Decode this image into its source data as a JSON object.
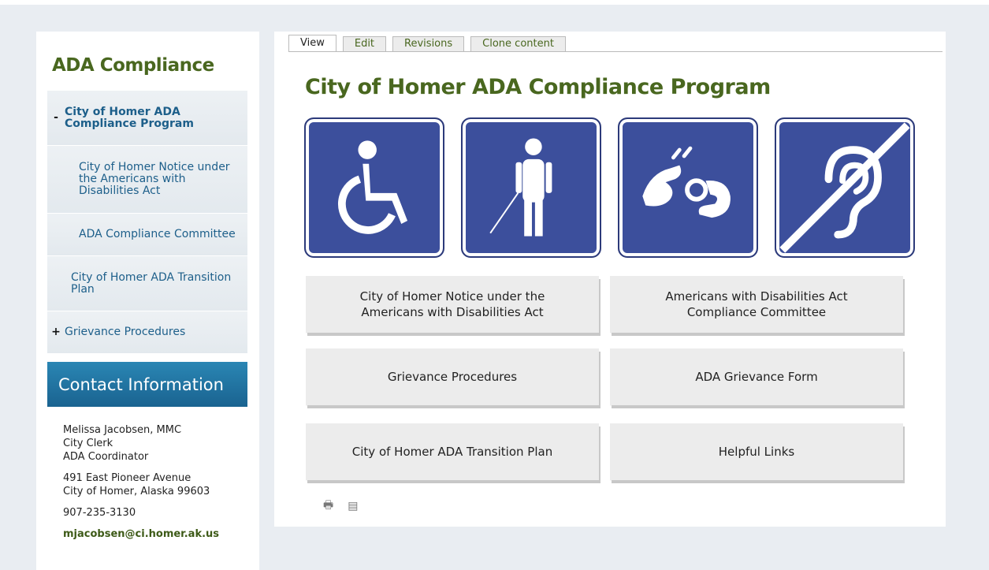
{
  "sidebar": {
    "title": "ADA Compliance",
    "items": [
      {
        "mark": "-",
        "label": "City of Homer ADA Compliance Program"
      },
      {
        "mark": "",
        "label": "City of Homer Notice under the Americans with Disabilities Act"
      },
      {
        "mark": "",
        "label": "ADA Compliance Committee"
      },
      {
        "mark": "",
        "label": "City of Homer ADA Transition Plan"
      },
      {
        "mark": "+",
        "label": "Grievance Procedures"
      }
    ],
    "contact_title": "Contact Information",
    "contact": {
      "name": "Melissa Jacobsen, MMC",
      "role1": "City Clerk",
      "role2": "ADA Coordinator",
      "addr1": "491 East Pioneer Avenue",
      "addr2": "City of Homer, Alaska 99603",
      "phone": "907-235-3130",
      "email": "mjacobsen@ci.homer.ak.us"
    }
  },
  "tabs": [
    {
      "label": "View"
    },
    {
      "label": "Edit"
    },
    {
      "label": "Revisions"
    },
    {
      "label": "Clone content"
    }
  ],
  "page_title": "City of Homer ADA Compliance Program",
  "icons": [
    "wheelchair-icon",
    "blind-person-icon",
    "sign-language-icon",
    "hearing-impaired-icon"
  ],
  "buttons": [
    {
      "label": "City of Homer Notice under the Americans with Disabilities Act"
    },
    {
      "label": "Americans with Disabilities Act Compliance Committee"
    },
    {
      "label": "Grievance Procedures"
    },
    {
      "label": "ADA Grievance Form"
    },
    {
      "label": "City of Homer ADA Transition Plan"
    },
    {
      "label": "Helpful Links"
    }
  ],
  "colors": {
    "accent_green": "#49671f",
    "link_blue": "#1d5f8a",
    "icon_blue": "#3c4f9c",
    "contact_blue": "#1a6390"
  }
}
